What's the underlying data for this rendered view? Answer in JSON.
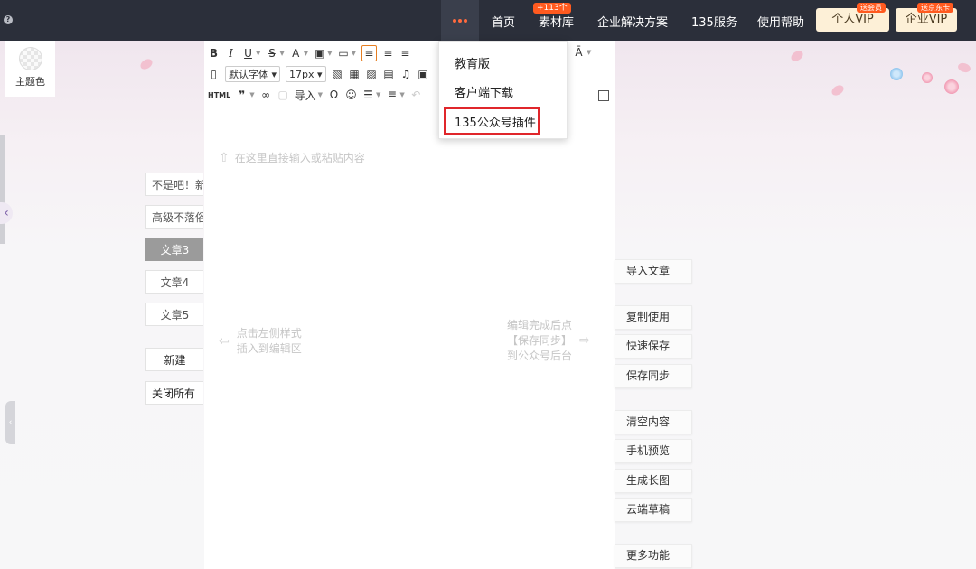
{
  "topbar": {
    "help_icon": "?",
    "more_badge": "+113个",
    "nav": [
      "首页",
      "素材库",
      "企业解决方案",
      "135服务",
      "使用帮助"
    ],
    "personal_vip": "个人VIP",
    "personal_vip_tag": "送会员",
    "enterprise_vip": "企业VIP",
    "enterprise_vip_tag": "送京东卡"
  },
  "dropdown": {
    "items": [
      "教育版",
      "客户端下载",
      "135公众号插件"
    ]
  },
  "theme": {
    "label": "主题色"
  },
  "articles": {
    "items": [
      "不是吧！新",
      "高级不落俗",
      "文章3",
      "文章4",
      "文章5"
    ],
    "new_label": "新建",
    "close_all_label": "关闭所有",
    "active_index": 2
  },
  "editor": {
    "font_family": "默认字体",
    "font_size": "17px",
    "html_label": "HTML",
    "import_label": "导入",
    "placeholder": "在这里直接输入或粘贴内容",
    "hint_left_1": "点击左侧样式",
    "hint_left_2": "插入到编辑区",
    "hint_right_1": "编辑完成后点",
    "hint_right_2": "【保存同步】",
    "hint_right_3": "到公众号后台"
  },
  "actions": [
    "导入文章",
    "复制使用",
    "快速保存",
    "保存同步",
    "清空内容",
    "手机预览",
    "生成长图",
    "云端草稿",
    "更多功能"
  ],
  "colors": {
    "topbar": "#2b2f3a",
    "accent": "#ff5a1f",
    "highlight": "#e0262b"
  }
}
